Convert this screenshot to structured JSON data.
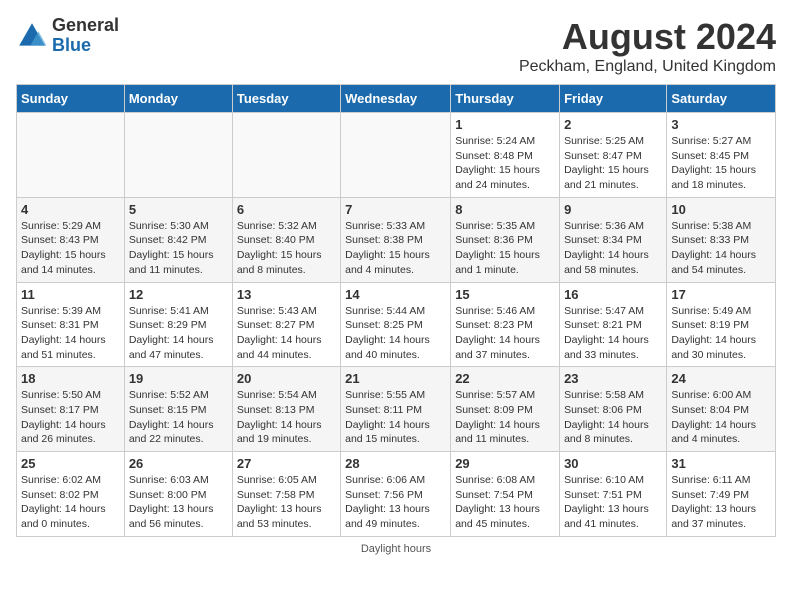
{
  "logo": {
    "general": "General",
    "blue": "Blue"
  },
  "header": {
    "month": "August 2024",
    "location": "Peckham, England, United Kingdom"
  },
  "days_of_week": [
    "Sunday",
    "Monday",
    "Tuesday",
    "Wednesday",
    "Thursday",
    "Friday",
    "Saturday"
  ],
  "footer": {
    "daylight_note": "Daylight hours"
  },
  "weeks": [
    [
      {
        "day": "",
        "sunrise": "",
        "sunset": "",
        "daylight": ""
      },
      {
        "day": "",
        "sunrise": "",
        "sunset": "",
        "daylight": ""
      },
      {
        "day": "",
        "sunrise": "",
        "sunset": "",
        "daylight": ""
      },
      {
        "day": "",
        "sunrise": "",
        "sunset": "",
        "daylight": ""
      },
      {
        "day": "1",
        "sunrise": "Sunrise: 5:24 AM",
        "sunset": "Sunset: 8:48 PM",
        "daylight": "Daylight: 15 hours and 24 minutes."
      },
      {
        "day": "2",
        "sunrise": "Sunrise: 5:25 AM",
        "sunset": "Sunset: 8:47 PM",
        "daylight": "Daylight: 15 hours and 21 minutes."
      },
      {
        "day": "3",
        "sunrise": "Sunrise: 5:27 AM",
        "sunset": "Sunset: 8:45 PM",
        "daylight": "Daylight: 15 hours and 18 minutes."
      }
    ],
    [
      {
        "day": "4",
        "sunrise": "Sunrise: 5:29 AM",
        "sunset": "Sunset: 8:43 PM",
        "daylight": "Daylight: 15 hours and 14 minutes."
      },
      {
        "day": "5",
        "sunrise": "Sunrise: 5:30 AM",
        "sunset": "Sunset: 8:42 PM",
        "daylight": "Daylight: 15 hours and 11 minutes."
      },
      {
        "day": "6",
        "sunrise": "Sunrise: 5:32 AM",
        "sunset": "Sunset: 8:40 PM",
        "daylight": "Daylight: 15 hours and 8 minutes."
      },
      {
        "day": "7",
        "sunrise": "Sunrise: 5:33 AM",
        "sunset": "Sunset: 8:38 PM",
        "daylight": "Daylight: 15 hours and 4 minutes."
      },
      {
        "day": "8",
        "sunrise": "Sunrise: 5:35 AM",
        "sunset": "Sunset: 8:36 PM",
        "daylight": "Daylight: 15 hours and 1 minute."
      },
      {
        "day": "9",
        "sunrise": "Sunrise: 5:36 AM",
        "sunset": "Sunset: 8:34 PM",
        "daylight": "Daylight: 14 hours and 58 minutes."
      },
      {
        "day": "10",
        "sunrise": "Sunrise: 5:38 AM",
        "sunset": "Sunset: 8:33 PM",
        "daylight": "Daylight: 14 hours and 54 minutes."
      }
    ],
    [
      {
        "day": "11",
        "sunrise": "Sunrise: 5:39 AM",
        "sunset": "Sunset: 8:31 PM",
        "daylight": "Daylight: 14 hours and 51 minutes."
      },
      {
        "day": "12",
        "sunrise": "Sunrise: 5:41 AM",
        "sunset": "Sunset: 8:29 PM",
        "daylight": "Daylight: 14 hours and 47 minutes."
      },
      {
        "day": "13",
        "sunrise": "Sunrise: 5:43 AM",
        "sunset": "Sunset: 8:27 PM",
        "daylight": "Daylight: 14 hours and 44 minutes."
      },
      {
        "day": "14",
        "sunrise": "Sunrise: 5:44 AM",
        "sunset": "Sunset: 8:25 PM",
        "daylight": "Daylight: 14 hours and 40 minutes."
      },
      {
        "day": "15",
        "sunrise": "Sunrise: 5:46 AM",
        "sunset": "Sunset: 8:23 PM",
        "daylight": "Daylight: 14 hours and 37 minutes."
      },
      {
        "day": "16",
        "sunrise": "Sunrise: 5:47 AM",
        "sunset": "Sunset: 8:21 PM",
        "daylight": "Daylight: 14 hours and 33 minutes."
      },
      {
        "day": "17",
        "sunrise": "Sunrise: 5:49 AM",
        "sunset": "Sunset: 8:19 PM",
        "daylight": "Daylight: 14 hours and 30 minutes."
      }
    ],
    [
      {
        "day": "18",
        "sunrise": "Sunrise: 5:50 AM",
        "sunset": "Sunset: 8:17 PM",
        "daylight": "Daylight: 14 hours and 26 minutes."
      },
      {
        "day": "19",
        "sunrise": "Sunrise: 5:52 AM",
        "sunset": "Sunset: 8:15 PM",
        "daylight": "Daylight: 14 hours and 22 minutes."
      },
      {
        "day": "20",
        "sunrise": "Sunrise: 5:54 AM",
        "sunset": "Sunset: 8:13 PM",
        "daylight": "Daylight: 14 hours and 19 minutes."
      },
      {
        "day": "21",
        "sunrise": "Sunrise: 5:55 AM",
        "sunset": "Sunset: 8:11 PM",
        "daylight": "Daylight: 14 hours and 15 minutes."
      },
      {
        "day": "22",
        "sunrise": "Sunrise: 5:57 AM",
        "sunset": "Sunset: 8:09 PM",
        "daylight": "Daylight: 14 hours and 11 minutes."
      },
      {
        "day": "23",
        "sunrise": "Sunrise: 5:58 AM",
        "sunset": "Sunset: 8:06 PM",
        "daylight": "Daylight: 14 hours and 8 minutes."
      },
      {
        "day": "24",
        "sunrise": "Sunrise: 6:00 AM",
        "sunset": "Sunset: 8:04 PM",
        "daylight": "Daylight: 14 hours and 4 minutes."
      }
    ],
    [
      {
        "day": "25",
        "sunrise": "Sunrise: 6:02 AM",
        "sunset": "Sunset: 8:02 PM",
        "daylight": "Daylight: 14 hours and 0 minutes."
      },
      {
        "day": "26",
        "sunrise": "Sunrise: 6:03 AM",
        "sunset": "Sunset: 8:00 PM",
        "daylight": "Daylight: 13 hours and 56 minutes."
      },
      {
        "day": "27",
        "sunrise": "Sunrise: 6:05 AM",
        "sunset": "Sunset: 7:58 PM",
        "daylight": "Daylight: 13 hours and 53 minutes."
      },
      {
        "day": "28",
        "sunrise": "Sunrise: 6:06 AM",
        "sunset": "Sunset: 7:56 PM",
        "daylight": "Daylight: 13 hours and 49 minutes."
      },
      {
        "day": "29",
        "sunrise": "Sunrise: 6:08 AM",
        "sunset": "Sunset: 7:54 PM",
        "daylight": "Daylight: 13 hours and 45 minutes."
      },
      {
        "day": "30",
        "sunrise": "Sunrise: 6:10 AM",
        "sunset": "Sunset: 7:51 PM",
        "daylight": "Daylight: 13 hours and 41 minutes."
      },
      {
        "day": "31",
        "sunrise": "Sunrise: 6:11 AM",
        "sunset": "Sunset: 7:49 PM",
        "daylight": "Daylight: 13 hours and 37 minutes."
      }
    ]
  ]
}
